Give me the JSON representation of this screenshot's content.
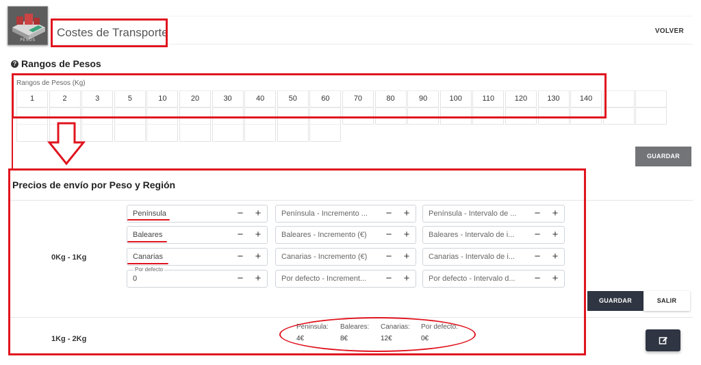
{
  "header": {
    "title": "Costes de Transporte",
    "back_label": "VOLVER",
    "icon_caption": "PESOS"
  },
  "rangos": {
    "heading": "Rangos de Pesos",
    "field_label": "Rangos de Pesos (Kg)",
    "values": [
      "1",
      "2",
      "3",
      "5",
      "10",
      "20",
      "30",
      "40",
      "50",
      "60",
      "70",
      "80",
      "90",
      "100",
      "110",
      "120",
      "130",
      "140",
      "",
      ""
    ],
    "save_label": "GUARDAR"
  },
  "precios": {
    "heading": "Precios de envío por Peso y Región",
    "row1": {
      "range": "0Kg - 1Kg",
      "fields": [
        [
          "Península",
          "Península - Incremento ...",
          "Península - Intervalo de ..."
        ],
        [
          "Baleares",
          "Baleares - Incremento (€)",
          "Baleares - Intervalo de i..."
        ],
        [
          "Canarias",
          "Canarias - Incremento (€)",
          "Canarias - Intervalo de i..."
        ],
        [
          "0",
          "Por defecto - Increment...",
          "Por defecto - Intervalo d..."
        ]
      ],
      "default_float_label": "Por defecto",
      "minus": "−",
      "plus": "+",
      "save_label": "GUARDAR",
      "exit_label": "SALIR"
    },
    "row2": {
      "range": "1Kg - 2Kg",
      "prices": [
        {
          "label": "Peninsula:",
          "value": "4€"
        },
        {
          "label": "Baleares:",
          "value": "8€"
        },
        {
          "label": "Canarias:",
          "value": "12€"
        },
        {
          "label": "Por defecto:",
          "value": "0€"
        }
      ]
    }
  },
  "colors": {
    "annotation_red": "#e0141e",
    "dark_button": "#2f3542",
    "grey_button": "#727478"
  }
}
